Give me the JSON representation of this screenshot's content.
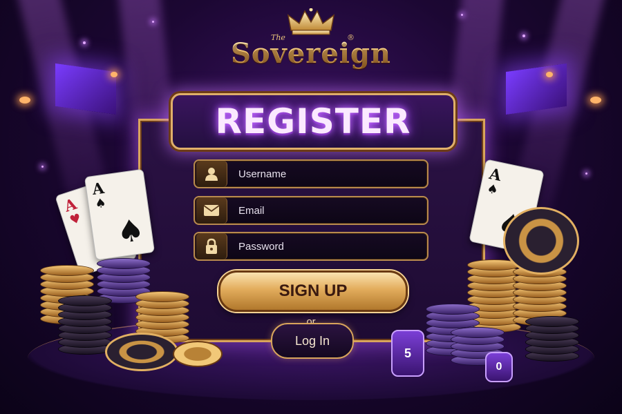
{
  "logo": {
    "prefix": "The",
    "name": "Sovereign",
    "suffix": "®"
  },
  "title": "REGISTER",
  "form": {
    "username_placeholder": "Username",
    "email_placeholder": "Email",
    "password_placeholder": "Password"
  },
  "signup_label": "SIGN UP",
  "or_label": "or",
  "login_label": "Log In",
  "cards_left": [
    {
      "rank": "A",
      "suit": "♥"
    },
    {
      "rank": "A",
      "suit": "♠"
    }
  ],
  "cards_right": [
    {
      "rank": "A",
      "suit": "♠"
    }
  ],
  "chip_labels": [
    "5",
    "0"
  ],
  "icons": {
    "username": "user-icon",
    "email": "envelope-icon",
    "password": "lock-icon",
    "logo": "crown-icon"
  },
  "colors": {
    "background": "#1c0733",
    "gold": "#e0b06a",
    "neon_purple": "#c46cff"
  }
}
